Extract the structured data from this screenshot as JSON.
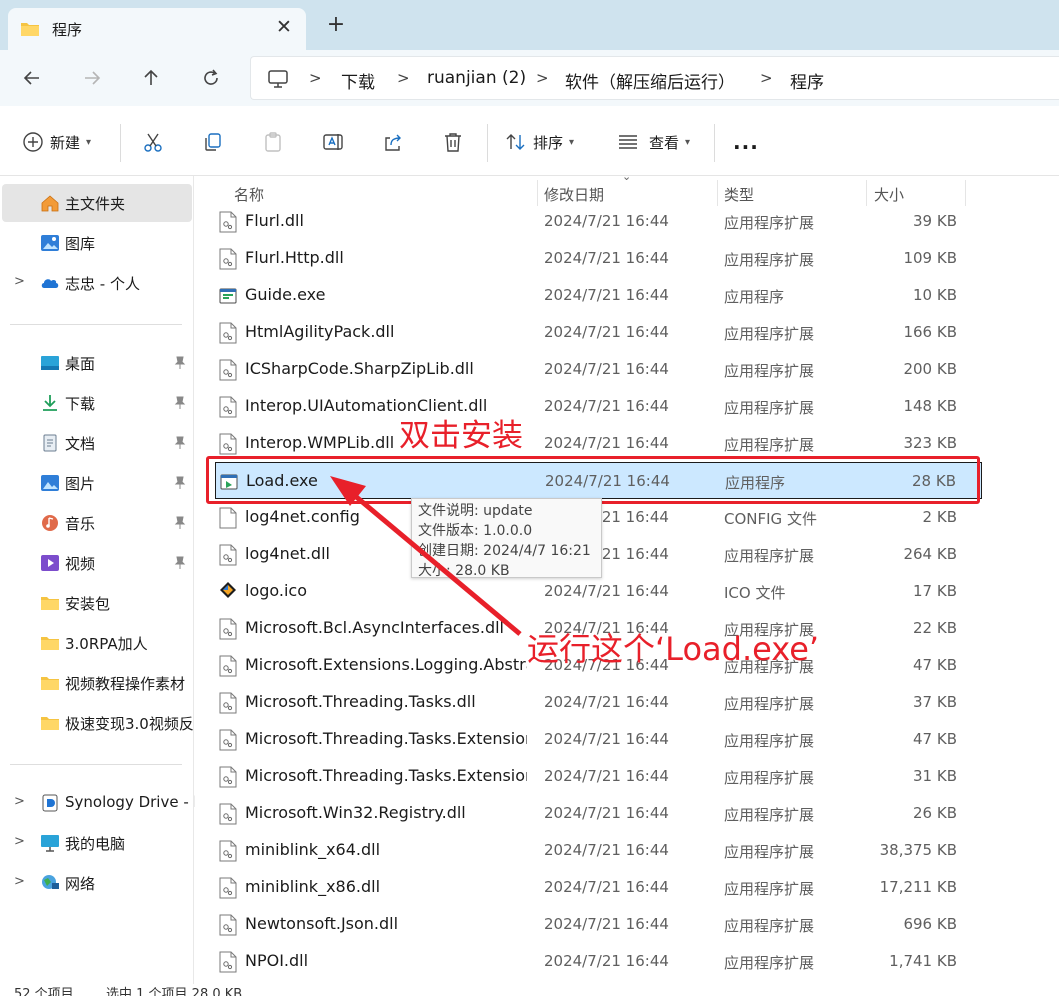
{
  "tab": {
    "title": "程序"
  },
  "breadcrumb": [
    "下载",
    "ruanjian (2)",
    "软件（解压缩后运行）",
    "程序"
  ],
  "toolbar": {
    "new_label": "新建",
    "sort_label": "排序",
    "view_label": "查看",
    "more_label": "..."
  },
  "sidebar": {
    "top": [
      {
        "label": "主文件夹",
        "icon": "home-icon"
      },
      {
        "label": "图库",
        "icon": "gallery-icon"
      },
      {
        "label": "志忠 - 个人",
        "icon": "onedrive-cloud-icon"
      }
    ],
    "pinned": [
      {
        "label": "桌面",
        "icon": "desktop-icon"
      },
      {
        "label": "下载",
        "icon": "download-icon"
      },
      {
        "label": "文档",
        "icon": "document-icon"
      },
      {
        "label": "图片",
        "icon": "pictures-icon"
      },
      {
        "label": "音乐",
        "icon": "music-icon"
      },
      {
        "label": "视频",
        "icon": "video-icon"
      },
      {
        "label": "安装包",
        "icon": "folder-icon"
      },
      {
        "label": "3.0RPA加人",
        "icon": "folder-icon"
      },
      {
        "label": "视频教程操作素材",
        "icon": "folder-icon"
      },
      {
        "label": "极速变现3.0视频反",
        "icon": "folder-icon"
      }
    ],
    "drives": [
      {
        "label": "Synology Drive - l",
        "icon": "synology-drive-icon"
      },
      {
        "label": "我的电脑",
        "icon": "computer-icon"
      },
      {
        "label": "网络",
        "icon": "network-icon"
      }
    ]
  },
  "columns": {
    "name": "名称",
    "modified": "修改日期",
    "type": "类型",
    "size": "大小"
  },
  "files": [
    {
      "name": "Flurl.dll",
      "modified": "2024/7/21 16:44",
      "type": "应用程序扩展",
      "size": "39 KB",
      "icon": "dll-file-icon"
    },
    {
      "name": "Flurl.Http.dll",
      "modified": "2024/7/21 16:44",
      "type": "应用程序扩展",
      "size": "109 KB",
      "icon": "dll-file-icon"
    },
    {
      "name": "Guide.exe",
      "modified": "2024/7/21 16:44",
      "type": "应用程序",
      "size": "10 KB",
      "icon": "exe-guide-icon"
    },
    {
      "name": "HtmlAgilityPack.dll",
      "modified": "2024/7/21 16:44",
      "type": "应用程序扩展",
      "size": "166 KB",
      "icon": "dll-file-icon"
    },
    {
      "name": "ICSharpCode.SharpZipLib.dll",
      "modified": "2024/7/21 16:44",
      "type": "应用程序扩展",
      "size": "200 KB",
      "icon": "dll-file-icon"
    },
    {
      "name": "Interop.UIAutomationClient.dll",
      "modified": "2024/7/21 16:44",
      "type": "应用程序扩展",
      "size": "148 KB",
      "icon": "dll-file-icon"
    },
    {
      "name": "Interop.WMPLib.dll",
      "modified": "2024/7/21 16:44",
      "type": "应用程序扩展",
      "size": "323 KB",
      "icon": "dll-file-icon"
    },
    {
      "name": "Load.exe",
      "modified": "2024/7/21 16:44",
      "type": "应用程序",
      "size": "28 KB",
      "icon": "exe-load-icon",
      "selected": true
    },
    {
      "name": "log4net.config",
      "modified": "2024/7/21 16:44",
      "type": "CONFIG 文件",
      "size": "2 KB",
      "icon": "config-file-icon"
    },
    {
      "name": "log4net.dll",
      "modified": "2024/7/21 16:44",
      "type": "应用程序扩展",
      "size": "264 KB",
      "icon": "dll-file-icon"
    },
    {
      "name": "logo.ico",
      "modified": "2024/7/21 16:44",
      "type": "ICO 文件",
      "size": "17 KB",
      "icon": "ico-file-icon"
    },
    {
      "name": "Microsoft.Bcl.AsyncInterfaces.dll",
      "modified": "2024/7/21 16:44",
      "type": "应用程序扩展",
      "size": "22 KB",
      "icon": "dll-file-icon"
    },
    {
      "name": "Microsoft.Extensions.Logging.Abstra...",
      "modified": "2024/7/21 16:44",
      "type": "应用程序扩展",
      "size": "47 KB",
      "icon": "dll-file-icon"
    },
    {
      "name": "Microsoft.Threading.Tasks.dll",
      "modified": "2024/7/21 16:44",
      "type": "应用程序扩展",
      "size": "37 KB",
      "icon": "dll-file-icon"
    },
    {
      "name": "Microsoft.Threading.Tasks.Extension...",
      "modified": "2024/7/21 16:44",
      "type": "应用程序扩展",
      "size": "47 KB",
      "icon": "dll-file-icon"
    },
    {
      "name": "Microsoft.Threading.Tasks.Extension...",
      "modified": "2024/7/21 16:44",
      "type": "应用程序扩展",
      "size": "31 KB",
      "icon": "dll-file-icon"
    },
    {
      "name": "Microsoft.Win32.Registry.dll",
      "modified": "2024/7/21 16:44",
      "type": "应用程序扩展",
      "size": "26 KB",
      "icon": "dll-file-icon"
    },
    {
      "name": "miniblink_x64.dll",
      "modified": "2024/7/21 16:44",
      "type": "应用程序扩展",
      "size": "38,375 KB",
      "icon": "dll-file-icon"
    },
    {
      "name": "miniblink_x86.dll",
      "modified": "2024/7/21 16:44",
      "type": "应用程序扩展",
      "size": "17,211 KB",
      "icon": "dll-file-icon"
    },
    {
      "name": "Newtonsoft.Json.dll",
      "modified": "2024/7/21 16:44",
      "type": "应用程序扩展",
      "size": "696 KB",
      "icon": "dll-file-icon"
    },
    {
      "name": "NPOI.dll",
      "modified": "2024/7/21 16:44",
      "type": "应用程序扩展",
      "size": "1,741 KB",
      "icon": "dll-file-icon"
    }
  ],
  "tooltip": [
    "文件说明: update",
    "文件版本: 1.0.0.0",
    "创建日期: 2024/4/7 16:21",
    "大小: 28.0 KB"
  ],
  "annotations": {
    "double_click": "双击安装",
    "run_this": "运行这个‘Load.exe’"
  },
  "status": {
    "item_count": "52 个项目",
    "selection": "选中 1 个项目  28.0 KB"
  },
  "colors": {
    "annotation_red": "#e8202a",
    "selection_blue": "#cce8ff",
    "tab_strip": "#cfe3ee"
  }
}
